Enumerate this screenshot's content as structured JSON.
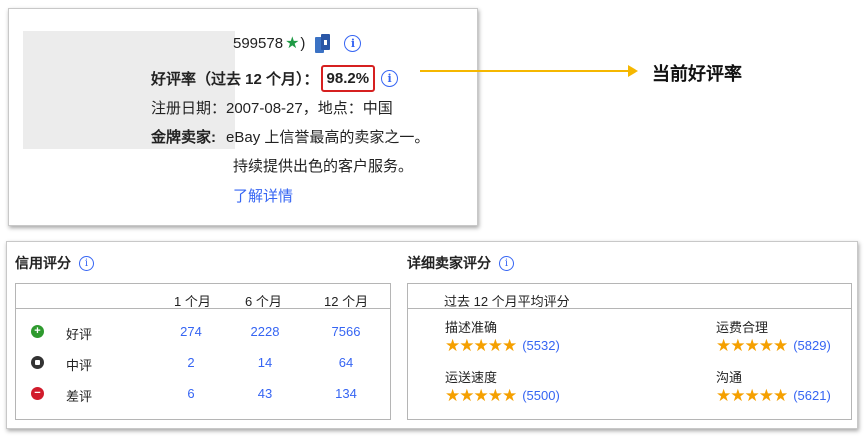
{
  "seller": {
    "score_fragment": "599578",
    "score_close": ")",
    "positive_label": "好评率（过去 12 个月）：",
    "positive_value": "98.2%",
    "registration": "注册日期：2007-08-27，地点：中国",
    "gold_label": "金牌卖家:",
    "gold_desc_1": "eBay 上信誉最高的卖家之一。",
    "gold_desc_2": "持续提供出色的客户服务。",
    "learn_more": "了解详情"
  },
  "annotation": {
    "callout": "当前好评率",
    "color": "#f5b700"
  },
  "credit": {
    "title": "信用评分",
    "columns": [
      "1 个月",
      "6 个月",
      "12 个月"
    ],
    "rows": [
      {
        "label": "好评",
        "icon": "plus-circle-icon",
        "color": "#2e9a2e",
        "values": [
          "274",
          "2228",
          "7566"
        ]
      },
      {
        "label": "中评",
        "icon": "neutral-circle-icon",
        "color": "#333333",
        "values": [
          "2",
          "14",
          "64"
        ]
      },
      {
        "label": "差评",
        "icon": "minus-circle-icon",
        "color": "#d11b2c",
        "values": [
          "6",
          "43",
          "134"
        ]
      }
    ]
  },
  "detail": {
    "title": "详细卖家评分",
    "subtitle": "过去 12 个月平均评分",
    "items": [
      {
        "name": "描述准确",
        "stars": 5,
        "count": "(5532)"
      },
      {
        "name": "运费合理",
        "stars": 5,
        "count": "(5829)"
      },
      {
        "name": "运送速度",
        "stars": 5,
        "count": "(5500)"
      },
      {
        "name": "沟通",
        "stars": 5,
        "count": "(5621)"
      }
    ]
  },
  "colors": {
    "link": "#3665f3",
    "highlight_box": "#d62020",
    "star": "#f5a000"
  }
}
